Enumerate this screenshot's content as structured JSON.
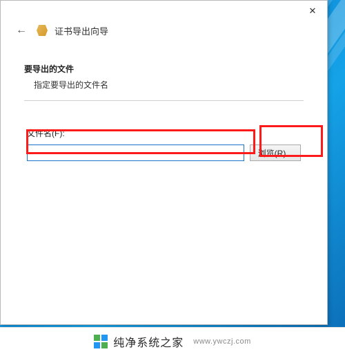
{
  "window": {
    "close_symbol": "✕"
  },
  "header": {
    "back_symbol": "←",
    "title": "证书导出向导"
  },
  "section": {
    "title": "要导出的文件",
    "subtitle": "指定要导出的文件名"
  },
  "file": {
    "label": "文件名(F):",
    "value": "",
    "browse_label": "浏览(R)..."
  },
  "watermark": {
    "brand": "纯净系统之家",
    "url": "www.ywczj.com"
  }
}
